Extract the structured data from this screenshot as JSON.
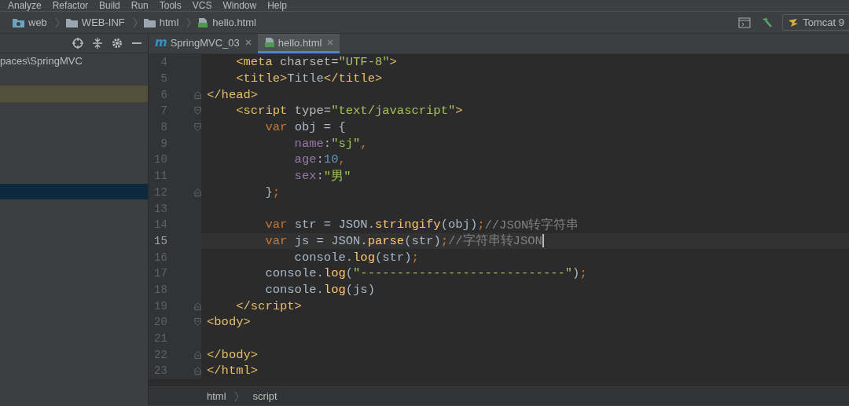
{
  "menu": [
    "Analyze",
    "Refactor",
    "Build",
    "Run",
    "Tools",
    "VCS",
    "Window",
    "Help"
  ],
  "nav_path": [
    {
      "label": "web",
      "kind": "web"
    },
    {
      "label": "WEB-INF",
      "kind": "folder"
    },
    {
      "label": "html",
      "kind": "folder"
    },
    {
      "label": "hello.html",
      "kind": "file"
    }
  ],
  "toolbar": {
    "run_config": "Tomcat 9"
  },
  "project_panel": {
    "path_text": "paces\\SpringMVC",
    "rows": [
      {
        "kind": "plain"
      },
      {
        "kind": "highlighted"
      },
      {
        "kind": "plain"
      },
      {
        "kind": "plain"
      },
      {
        "kind": "plain"
      },
      {
        "kind": "plain"
      },
      {
        "kind": "plain"
      },
      {
        "kind": "selected"
      }
    ]
  },
  "tabs": [
    {
      "label": "SpringMVC_03",
      "kind": "maven",
      "icon_letter": "m",
      "selected": false
    },
    {
      "label": "hello.html",
      "kind": "file",
      "selected": true
    }
  ],
  "editor": {
    "lines": [
      {
        "number": "4",
        "kind": "code",
        "current": false,
        "tokens": [
          {
            "kind": "tag",
            "text": "    <meta"
          },
          {
            "kind": "attr",
            "text": " charset="
          },
          {
            "kind": "string",
            "text": "\"UTF-8\""
          },
          {
            "kind": "tag",
            "text": ">"
          }
        ]
      },
      {
        "number": "5",
        "kind": "code",
        "current": false,
        "tokens": [
          {
            "kind": "tag",
            "text": "    <title>"
          },
          {
            "kind": "plain",
            "text": "Title"
          },
          {
            "kind": "tag",
            "text": "</title>"
          }
        ]
      },
      {
        "number": "6",
        "kind": "fold-end",
        "current": false,
        "tokens": [
          {
            "kind": "tag",
            "text": "</head>"
          }
        ]
      },
      {
        "number": "7",
        "kind": "fold-start",
        "current": false,
        "tokens": [
          {
            "kind": "tag",
            "text": "    <script"
          },
          {
            "kind": "attr",
            "text": " type="
          },
          {
            "kind": "string",
            "text": "\"text/javascript\""
          },
          {
            "kind": "tag",
            "text": ">"
          }
        ]
      },
      {
        "number": "8",
        "kind": "fold-start",
        "current": false,
        "tokens": [
          {
            "kind": "keyword",
            "text": "        var"
          },
          {
            "kind": "plain",
            "text": " obj = {"
          }
        ]
      },
      {
        "number": "9",
        "kind": "code",
        "current": false,
        "tokens": [
          {
            "kind": "field",
            "text": "            name"
          },
          {
            "kind": "plain",
            "text": ":"
          },
          {
            "kind": "string",
            "text": "\"sj\""
          },
          {
            "kind": "keyword",
            "text": ","
          }
        ]
      },
      {
        "number": "10",
        "kind": "code",
        "current": false,
        "tokens": [
          {
            "kind": "field",
            "text": "            age"
          },
          {
            "kind": "plain",
            "text": ":"
          },
          {
            "kind": "number",
            "text": "10"
          },
          {
            "kind": "keyword",
            "text": ","
          }
        ]
      },
      {
        "number": "11",
        "kind": "code",
        "current": false,
        "tokens": [
          {
            "kind": "field",
            "text": "            sex"
          },
          {
            "kind": "plain",
            "text": ":"
          },
          {
            "kind": "string",
            "text": "\"男\""
          }
        ]
      },
      {
        "number": "12",
        "kind": "fold-end",
        "current": false,
        "tokens": [
          {
            "kind": "plain",
            "text": "        }"
          },
          {
            "kind": "keyword",
            "text": ";"
          }
        ]
      },
      {
        "number": "13",
        "kind": "code",
        "current": false
      },
      {
        "number": "14",
        "kind": "code",
        "current": false,
        "tokens": [
          {
            "kind": "keyword",
            "text": "        var"
          },
          {
            "kind": "plain",
            "text": " str = JSON."
          },
          {
            "kind": "func",
            "text": "stringify"
          },
          {
            "kind": "plain",
            "text": "(obj)"
          },
          {
            "kind": "keyword",
            "text": ";"
          },
          {
            "kind": "comment",
            "text": "//JSON转字符串"
          }
        ]
      },
      {
        "number": "15",
        "kind": "code",
        "current": true,
        "tokens": [
          {
            "kind": "keyword",
            "text": "        var"
          },
          {
            "kind": "plain",
            "text": " js = JSON."
          },
          {
            "kind": "func",
            "text": "parse"
          },
          {
            "kind": "plain",
            "text": "(str)"
          },
          {
            "kind": "keyword",
            "text": ";"
          },
          {
            "kind": "comment",
            "text": "//字符串转JSON"
          }
        ]
      },
      {
        "number": "16",
        "kind": "code",
        "current": false,
        "tokens": [
          {
            "kind": "plain",
            "text": "            console."
          },
          {
            "kind": "func",
            "text": "log"
          },
          {
            "kind": "plain",
            "text": "(str)"
          },
          {
            "kind": "keyword",
            "text": ";"
          }
        ]
      },
      {
        "number": "17",
        "kind": "code",
        "current": false,
        "tokens": [
          {
            "kind": "plain",
            "text": "        console."
          },
          {
            "kind": "func",
            "text": "log"
          },
          {
            "kind": "plain",
            "text": "("
          },
          {
            "kind": "string",
            "text": "\"----------------------------\""
          },
          {
            "kind": "plain",
            "text": ")"
          },
          {
            "kind": "keyword",
            "text": ";"
          }
        ]
      },
      {
        "number": "18",
        "kind": "code",
        "current": false,
        "tokens": [
          {
            "kind": "plain",
            "text": "        console."
          },
          {
            "kind": "func",
            "text": "log"
          },
          {
            "kind": "plain",
            "text": "(js)"
          }
        ]
      },
      {
        "number": "19",
        "kind": "fold-end",
        "current": false,
        "tokens": [
          {
            "kind": "tag",
            "text": "    </script>"
          }
        ]
      },
      {
        "number": "20",
        "kind": "fold-start",
        "current": false,
        "tokens": [
          {
            "kind": "tag",
            "text": "<body>"
          }
        ]
      },
      {
        "number": "21",
        "kind": "code",
        "current": false
      },
      {
        "number": "22",
        "kind": "fold-end",
        "current": false,
        "tokens": [
          {
            "kind": "tag",
            "text": "</body>"
          }
        ]
      },
      {
        "number": "23",
        "kind": "fold-end",
        "current": false,
        "tokens": [
          {
            "kind": "tag",
            "text": "</html>"
          }
        ]
      }
    ]
  },
  "breadcrumbs": [
    "html",
    "script"
  ]
}
